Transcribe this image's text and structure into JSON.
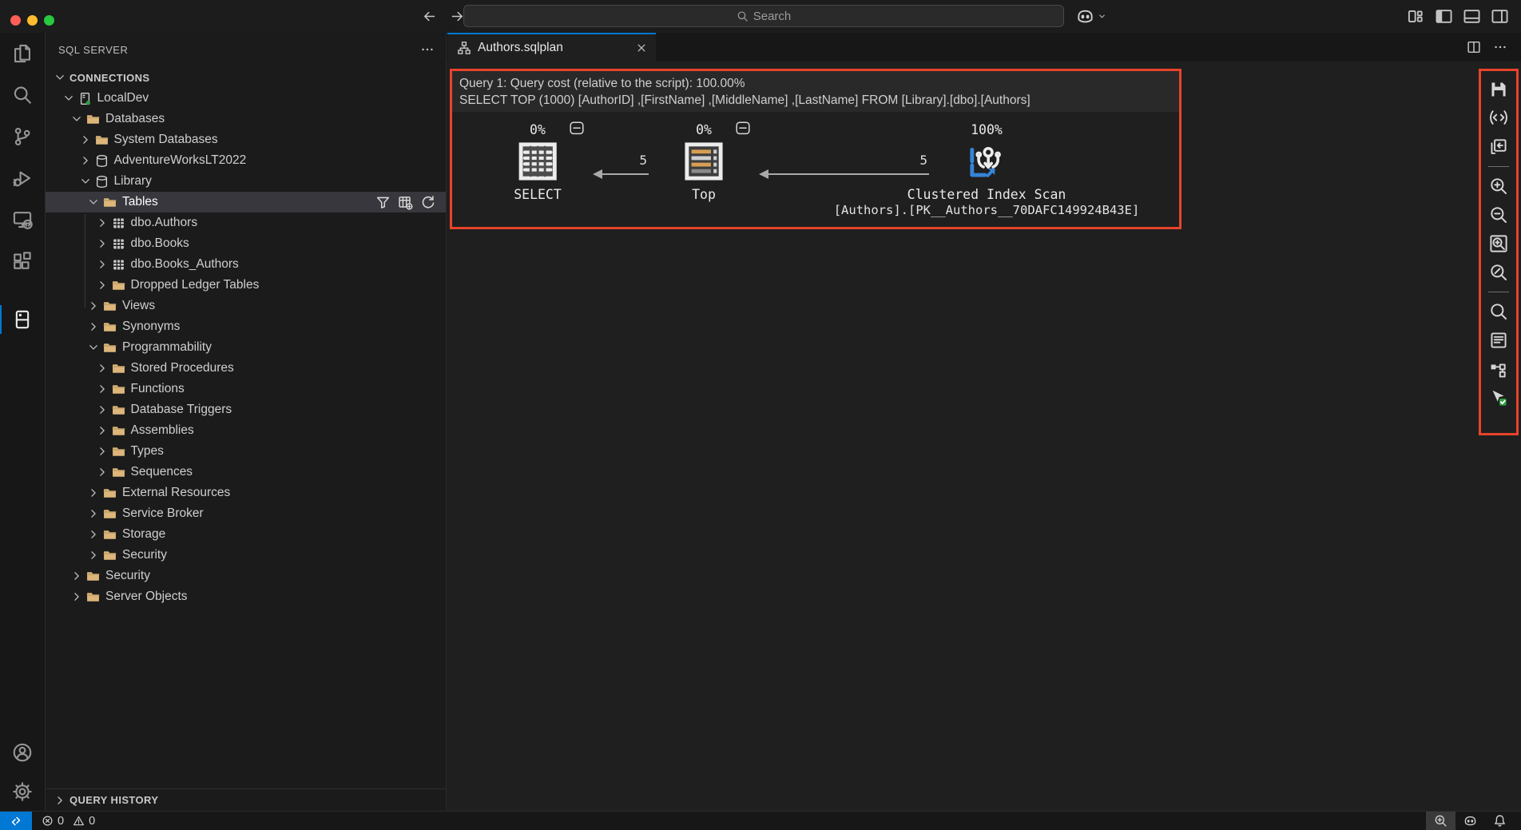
{
  "title_bar": {
    "search_placeholder": "Search",
    "traffic_colors": [
      "#ff5f57",
      "#febc2e",
      "#28c840"
    ],
    "window_controls": [
      "layout-control",
      "panel-left",
      "panel-bottom",
      "panel-right"
    ]
  },
  "activity_bar": {
    "items": [
      {
        "icon": "explorer",
        "name": "explorer"
      },
      {
        "icon": "search",
        "name": "search"
      },
      {
        "icon": "source-control",
        "name": "source-control"
      },
      {
        "icon": "run-debug",
        "name": "run-and-debug"
      },
      {
        "icon": "remote-explorer",
        "name": "remote-explorer"
      },
      {
        "icon": "extensions",
        "name": "extensions"
      },
      {
        "icon": "sql-server",
        "name": "sql-server",
        "active": true,
        "gap": true
      }
    ],
    "bottom": [
      {
        "icon": "account",
        "name": "accounts"
      },
      {
        "icon": "settings-gear",
        "name": "settings"
      }
    ]
  },
  "sidebar": {
    "title": "SQL SERVER",
    "connections_header": "CONNECTIONS",
    "query_history_header": "QUERY HISTORY",
    "tree": [
      {
        "label": "LocalDev",
        "level": 1,
        "chevron": "down",
        "icon": "server"
      },
      {
        "label": "Databases",
        "level": 2,
        "chevron": "down",
        "icon": "folder"
      },
      {
        "label": "System Databases",
        "level": 3,
        "chevron": "right",
        "icon": "folder"
      },
      {
        "label": "AdventureWorksLT2022",
        "level": 3,
        "chevron": "right",
        "icon": "database"
      },
      {
        "label": "Library",
        "level": 3,
        "chevron": "down",
        "icon": "database"
      },
      {
        "label": "Tables",
        "level": 4,
        "chevron": "down",
        "icon": "folder",
        "selected": true,
        "actions": [
          "filter",
          "new-table",
          "refresh"
        ]
      },
      {
        "label": "dbo.Authors",
        "level": 5,
        "chevron": "right",
        "icon": "table"
      },
      {
        "label": "dbo.Books",
        "level": 5,
        "chevron": "right",
        "icon": "table"
      },
      {
        "label": "dbo.Books_Authors",
        "level": 5,
        "chevron": "right",
        "icon": "table"
      },
      {
        "label": "Dropped Ledger Tables",
        "level": 5,
        "chevron": "right",
        "icon": "folder"
      },
      {
        "label": "Views",
        "level": 4,
        "chevron": "right",
        "icon": "folder"
      },
      {
        "label": "Synonyms",
        "level": 4,
        "chevron": "right",
        "icon": "folder"
      },
      {
        "label": "Programmability",
        "level": 4,
        "chevron": "down",
        "icon": "folder"
      },
      {
        "label": "Stored Procedures",
        "level": 5,
        "chevron": "right",
        "icon": "folder"
      },
      {
        "label": "Functions",
        "level": 5,
        "chevron": "right",
        "icon": "folder"
      },
      {
        "label": "Database Triggers",
        "level": 5,
        "chevron": "right",
        "icon": "folder"
      },
      {
        "label": "Assemblies",
        "level": 5,
        "chevron": "right",
        "icon": "folder"
      },
      {
        "label": "Types",
        "level": 5,
        "chevron": "right",
        "icon": "folder"
      },
      {
        "label": "Sequences",
        "level": 5,
        "chevron": "right",
        "icon": "folder"
      },
      {
        "label": "External Resources",
        "level": 4,
        "chevron": "right",
        "icon": "folder"
      },
      {
        "label": "Service Broker",
        "level": 4,
        "chevron": "right",
        "icon": "folder"
      },
      {
        "label": "Storage",
        "level": 4,
        "chevron": "right",
        "icon": "folder"
      },
      {
        "label": "Security",
        "level": 4,
        "chevron": "right",
        "icon": "folder"
      },
      {
        "label": "Security",
        "level": 2,
        "chevron": "right",
        "icon": "folder"
      },
      {
        "label": "Server Objects",
        "level": 2,
        "chevron": "right",
        "icon": "folder"
      }
    ]
  },
  "editor": {
    "tab_label": "Authors.sqlplan",
    "plan": {
      "query_cost_line": "Query 1: Query cost (relative to the script): 100.00%",
      "query_text_line": "SELECT TOP (1000) [AuthorID] ,[FirstName] ,[MiddleName] ,[LastName] FROM [Library].[dbo].[Authors]",
      "nodes": [
        {
          "percent": "0%",
          "icon": "select-operator",
          "label": "SELECT"
        },
        {
          "percent": "0%",
          "icon": "top-operator",
          "label": "Top"
        },
        {
          "percent": "100%",
          "icon": "clustered-index-scan-operator",
          "label": "Clustered Index Scan",
          "sublabel": "[Authors].[PK__Authors__70DAFC149924B43E]"
        }
      ],
      "edges": [
        {
          "row_count": "5"
        },
        {
          "row_count": "5"
        }
      ],
      "toolbar": [
        "save-plan",
        "open-plan-xml",
        "open-query",
        "divider",
        "zoom-in",
        "zoom-out",
        "zoom-to-fit",
        "custom-zoom",
        "divider",
        "find-node",
        "properties",
        "highlight-expensive-operation",
        "toggle-tooltip"
      ]
    }
  },
  "status_bar": {
    "error_count": "0",
    "warning_count": "0"
  },
  "colors": {
    "accent_blue": "#0078d4",
    "highlight_red": "#e8432b",
    "folder_tan": "#dcb67a",
    "status_green": "#2ea043"
  }
}
